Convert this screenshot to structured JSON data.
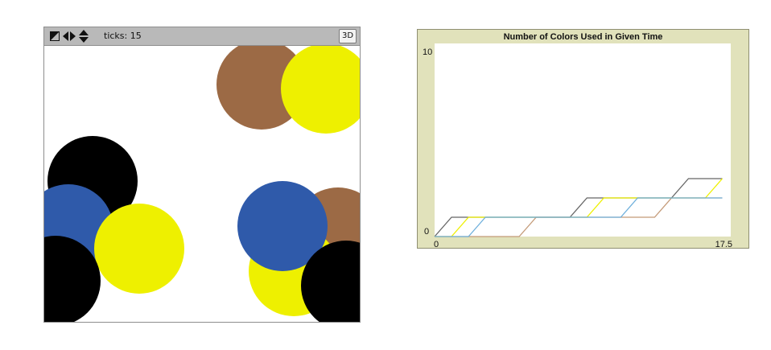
{
  "view": {
    "ticks_label": "ticks: 15",
    "three_d_label": "3D",
    "controls": [
      "size-toggle-icon",
      "horizontal-arrows-icon",
      "vertical-arrows-icon"
    ],
    "turtles": [
      {
        "color": "brown",
        "x": 270,
        "y": 48
      },
      {
        "color": "yellow",
        "x": 350,
        "y": 53
      },
      {
        "color": "black",
        "x": 60,
        "y": 168
      },
      {
        "color": "blue",
        "x": 30,
        "y": 228
      },
      {
        "color": "yellow",
        "x": 118,
        "y": 252
      },
      {
        "color": "black",
        "x": 14,
        "y": 292
      },
      {
        "color": "brown",
        "x": 365,
        "y": 232
      },
      {
        "color": "yellow",
        "x": 310,
        "y": 280
      },
      {
        "color": "blue",
        "x": 296,
        "y": 224
      },
      {
        "color": "black",
        "x": 375,
        "y": 298
      }
    ],
    "colors": {
      "black": "#000000",
      "yellow": "#eef000",
      "brown": "#9c6a45",
      "blue": "#2f5aaa"
    }
  },
  "plot": {
    "title": "Number of Colors Used in Given Time",
    "background": "#e1e2bb",
    "plot_area": "#ffffff"
  },
  "chart_data": {
    "type": "line",
    "title": "Number of Colors Used in Given Time",
    "xlim": [
      0,
      17.5
    ],
    "ylim": [
      0,
      10
    ],
    "x_tick_labels": [
      "0",
      "17.5"
    ],
    "y_tick_labels": [
      "0",
      "10"
    ],
    "grid": false,
    "legend": "none",
    "series": [
      {
        "color": "#666666",
        "points": [
          [
            0,
            0
          ],
          [
            1,
            1
          ],
          [
            2,
            1
          ],
          [
            3,
            1
          ],
          [
            4,
            1
          ],
          [
            5,
            1
          ],
          [
            6,
            1
          ],
          [
            7,
            1
          ],
          [
            8,
            1
          ],
          [
            9,
            2
          ],
          [
            10,
            2
          ],
          [
            11,
            2
          ],
          [
            12,
            2
          ],
          [
            13,
            2
          ],
          [
            14,
            2
          ],
          [
            15,
            3
          ],
          [
            16,
            3
          ],
          [
            17,
            3
          ]
        ]
      },
      {
        "color": "#eef000",
        "points": [
          [
            0,
            0
          ],
          [
            1,
            0
          ],
          [
            2,
            1
          ],
          [
            3,
            1
          ],
          [
            4,
            1
          ],
          [
            5,
            1
          ],
          [
            6,
            1
          ],
          [
            7,
            1
          ],
          [
            8,
            1
          ],
          [
            9,
            1
          ],
          [
            10,
            2
          ],
          [
            11,
            2
          ],
          [
            12,
            2
          ],
          [
            13,
            2
          ],
          [
            14,
            2
          ],
          [
            15,
            2
          ],
          [
            16,
            2
          ],
          [
            17,
            3
          ]
        ]
      },
      {
        "color": "#c49a78",
        "points": [
          [
            0,
            0
          ],
          [
            1,
            0
          ],
          [
            2,
            0
          ],
          [
            3,
            0
          ],
          [
            4,
            0
          ],
          [
            5,
            0
          ],
          [
            6,
            1
          ],
          [
            7,
            1
          ],
          [
            8,
            1
          ],
          [
            9,
            1
          ],
          [
            10,
            1
          ],
          [
            11,
            1
          ],
          [
            12,
            1
          ],
          [
            13,
            1
          ],
          [
            14,
            2
          ],
          [
            15,
            2
          ],
          [
            16,
            2
          ],
          [
            17,
            2
          ]
        ]
      },
      {
        "color": "#6fb0dc",
        "points": [
          [
            0,
            0
          ],
          [
            1,
            0
          ],
          [
            2,
            0
          ],
          [
            3,
            1
          ],
          [
            4,
            1
          ],
          [
            5,
            1
          ],
          [
            6,
            1
          ],
          [
            7,
            1
          ],
          [
            8,
            1
          ],
          [
            9,
            1
          ],
          [
            10,
            1
          ],
          [
            11,
            1
          ],
          [
            12,
            2
          ],
          [
            13,
            2
          ],
          [
            14,
            2
          ],
          [
            15,
            2
          ],
          [
            16,
            2
          ],
          [
            17,
            2
          ]
        ]
      }
    ]
  }
}
